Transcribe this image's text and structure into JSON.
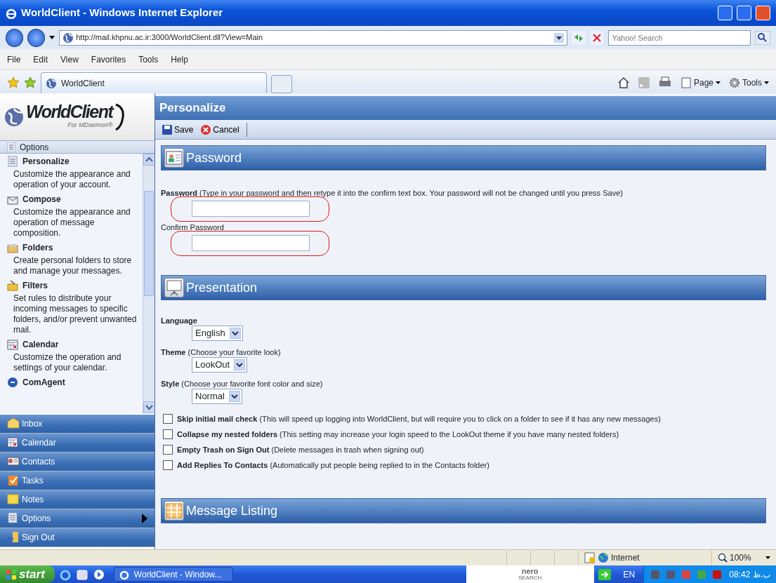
{
  "window": {
    "title": "WorldClient - Windows Internet Explorer"
  },
  "address_bar": {
    "url": "http://mail.khpnu.ac.ir:3000/WorldClient.dll?View=Main",
    "search_placeholder": "Yahoo! Search"
  },
  "menu_bar": [
    "File",
    "Edit",
    "View",
    "Favorites",
    "Tools",
    "Help"
  ],
  "tabs": [
    {
      "label": "WorldClient",
      "selected": true
    }
  ],
  "command_bar": [
    {
      "label": "Page"
    },
    {
      "label": "Tools"
    }
  ],
  "sidebar": {
    "logo": {
      "title": "WorldClient",
      "subtitle": "For MDaemon®"
    },
    "header": "Options",
    "items": [
      {
        "title": "Personalize",
        "description": "Customize the appearance and operation of your account.",
        "kind": "personalize"
      },
      {
        "title": "Compose",
        "description": "Customize the appearance and operation of message composition.",
        "kind": "compose"
      },
      {
        "title": "Folders",
        "description": "Create personal folders to store and manage your messages.",
        "kind": "folders"
      },
      {
        "title": "Filters",
        "description": "Set rules to distribute your incoming messages to specific folders, and/or prevent unwanted mail.",
        "kind": "filters"
      },
      {
        "title": "Calendar",
        "description": "Customize the operation and settings of your calendar.",
        "kind": "calendar"
      },
      {
        "title": "ComAgent",
        "kind": "comagent"
      }
    ],
    "nav": [
      {
        "label": "Inbox",
        "kind": "inbox",
        "submenu": false
      },
      {
        "label": "Calendar",
        "kind": "calendar",
        "submenu": false
      },
      {
        "label": "Contacts",
        "kind": "contacts",
        "submenu": false
      },
      {
        "label": "Tasks",
        "kind": "tasks",
        "submenu": false
      },
      {
        "label": "Notes",
        "kind": "notes",
        "submenu": false
      },
      {
        "label": "Options",
        "kind": "options",
        "submenu": true
      },
      {
        "label": "Sign Out",
        "kind": "signout",
        "submenu": false
      }
    ]
  },
  "page": {
    "title": "Personalize",
    "toolbar": [
      {
        "label": "Save",
        "kind": "save"
      },
      {
        "label": "Cancel",
        "kind": "cancel"
      }
    ],
    "sections": [
      {
        "title": "Password",
        "kind": "password",
        "fields": [
          {
            "label": "**Password** (Type in your password and then retype it into the confirm text box. Your password will not be changed until you press Save)",
            "highlighted": true
          },
          {
            "label": "Confirm Password",
            "highlighted": true
          }
        ]
      },
      {
        "title": "Presentation",
        "kind": "presentation",
        "selects": [
          {
            "label": "**Language**",
            "value": "English"
          },
          {
            "label": "**Theme** (Choose your favorite look)",
            "value": "LookOut"
          },
          {
            "label": "**Style** (Choose your favorite font color and size)",
            "value": "Normal"
          }
        ],
        "checkboxes": [
          {
            "label": "**Skip initial mail check** (This will speed up logging into WorldClient, but will require you to click on a folder to see if it has any new messages)",
            "checked": false
          },
          {
            "label": "**Collapse my nested folders** (This setting may increase your login speed to the LookOut theme if you have many nested folders)",
            "checked": false
          },
          {
            "label": "**Empty Trash on Sign Out** (Delete messages in trash when signing out)",
            "checked": false
          },
          {
            "label": "**Add Replies To Contacts** (Automatically put people being replied to in the Contacts folder)",
            "checked": false
          }
        ]
      },
      {
        "title": "Message Listing",
        "kind": "listing"
      }
    ]
  },
  "status_bar": {
    "zone": "Internet",
    "zoom": "100%"
  },
  "taskbar": {
    "start": "start",
    "window": "WorldClient - Window...",
    "search_logo": "nero",
    "search_logo_sub": "SEARCH",
    "language": "EN",
    "clock": "08:42 ب.ظ"
  }
}
